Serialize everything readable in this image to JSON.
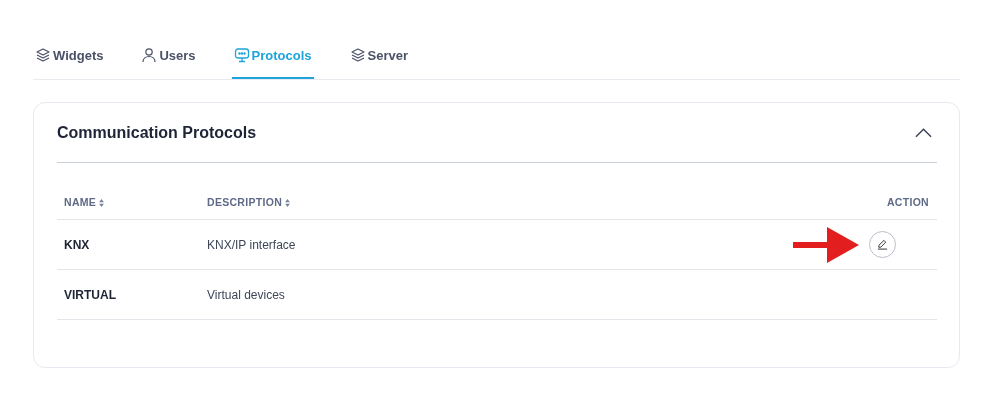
{
  "tabs": [
    {
      "label": "Widgets",
      "kind": "layers",
      "selected": false
    },
    {
      "label": "Users",
      "kind": "user",
      "selected": false
    },
    {
      "label": "Protocols",
      "kind": "monitor",
      "selected": true
    },
    {
      "label": "Server",
      "kind": "layers",
      "selected": false
    }
  ],
  "panel": {
    "title": "Communication Protocols",
    "expanded": true,
    "table": {
      "columns": [
        {
          "label": "NAME",
          "sortable": true
        },
        {
          "label": "DESCRIPTION",
          "sortable": true
        },
        {
          "label": "ACTION",
          "sortable": false
        }
      ],
      "rows": [
        {
          "name": "KNX",
          "description": "KNX/IP interface",
          "editable": true,
          "pointed": true
        },
        {
          "name": "VIRTUAL",
          "description": "Virtual devices",
          "editable": false,
          "pointed": false
        }
      ]
    }
  }
}
